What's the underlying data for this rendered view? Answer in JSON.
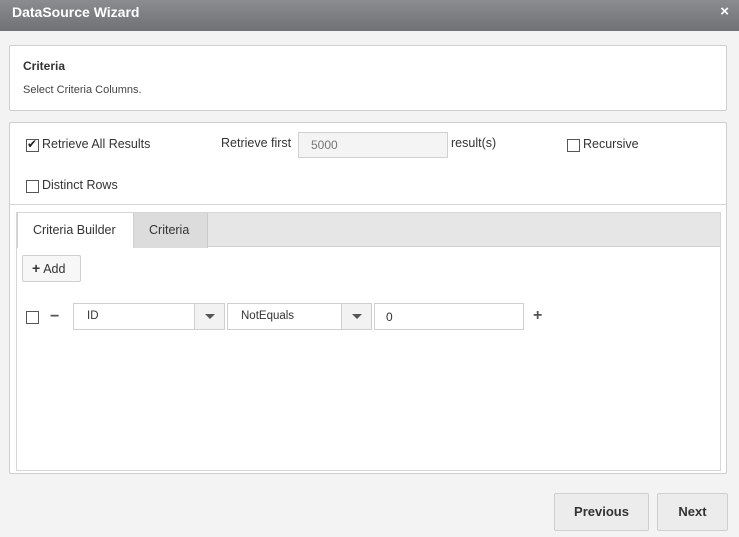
{
  "window": {
    "title": "DataSource Wizard",
    "close_icon": "×"
  },
  "header": {
    "title": "Criteria",
    "subtitle": "Select Criteria Columns."
  },
  "options": {
    "retrieve_all": {
      "label": "Retrieve All Results",
      "checked": true
    },
    "retrieve_first_label": "Retrieve first",
    "retrieve_first_placeholder": "5000",
    "results_suffix": "result(s)",
    "recursive": {
      "label": "Recursive",
      "checked": false
    },
    "distinct": {
      "label": "Distinct Rows",
      "checked": false
    }
  },
  "tabs": [
    {
      "label": "Criteria Builder",
      "active": true
    },
    {
      "label": "Criteria",
      "active": false
    }
  ],
  "builder": {
    "add_label": "Add",
    "rows": [
      {
        "column": "ID",
        "operator": "NotEquals",
        "value": "0"
      }
    ]
  },
  "footer": {
    "previous_label": "Previous",
    "next_label": "Next"
  }
}
